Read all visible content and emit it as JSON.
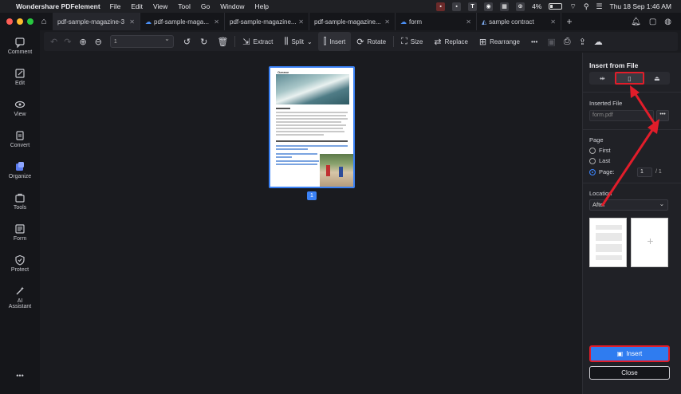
{
  "menubar": {
    "app_name": "Wondershare PDFelement",
    "menus": [
      "File",
      "Edit",
      "View",
      "Tool",
      "Go",
      "Window",
      "Help"
    ],
    "battery": "4%",
    "clock": "Thu 18 Sep  1:46 AM",
    "status_letter": "T"
  },
  "tabs": [
    {
      "label": "pdf-sample-magazine-3",
      "cloud": false,
      "active": true
    },
    {
      "label": "pdf-sample-maga...",
      "cloud": true,
      "active": false
    },
    {
      "label": "pdf-sample-magazine...",
      "cloud": false,
      "active": false
    },
    {
      "label": "pdf-sample-magazine...",
      "cloud": false,
      "active": false
    },
    {
      "label": "form",
      "cloud": true,
      "active": false
    },
    {
      "label": "sample contract",
      "cloud": false,
      "active": false
    }
  ],
  "sidebar": {
    "items": [
      {
        "label": "Comment"
      },
      {
        "label": "Edit"
      },
      {
        "label": "View"
      },
      {
        "label": "Convert"
      },
      {
        "label": "Organize"
      },
      {
        "label": "Tools"
      },
      {
        "label": "Form"
      },
      {
        "label": "Protect"
      },
      {
        "label": "AI",
        "label2": "Assistant"
      }
    ],
    "more": "•••"
  },
  "toolbar": {
    "page_value": "1",
    "extract": "Extract",
    "split": "Split",
    "insert": "Insert",
    "rotate": "Rotate",
    "size": "Size",
    "replace": "Replace",
    "rearrange": "Rearrange",
    "more": "•••"
  },
  "document": {
    "page_number": "1",
    "thumb_title": "Ozeane"
  },
  "panel": {
    "title": "Insert from File",
    "inserted_file_label": "Inserted File",
    "inserted_file_value": "form.pdf",
    "browse": "•••",
    "page_label": "Page",
    "first": "First",
    "last": "Last",
    "page_opt": "Page:",
    "page_value": "1",
    "page_total": "/ 1",
    "location_label": "Location",
    "location_value": "After",
    "insert_button": "Insert",
    "close_button": "Close"
  },
  "colors": {
    "accent": "#2f7cf0",
    "highlight": "#e11d2a"
  }
}
